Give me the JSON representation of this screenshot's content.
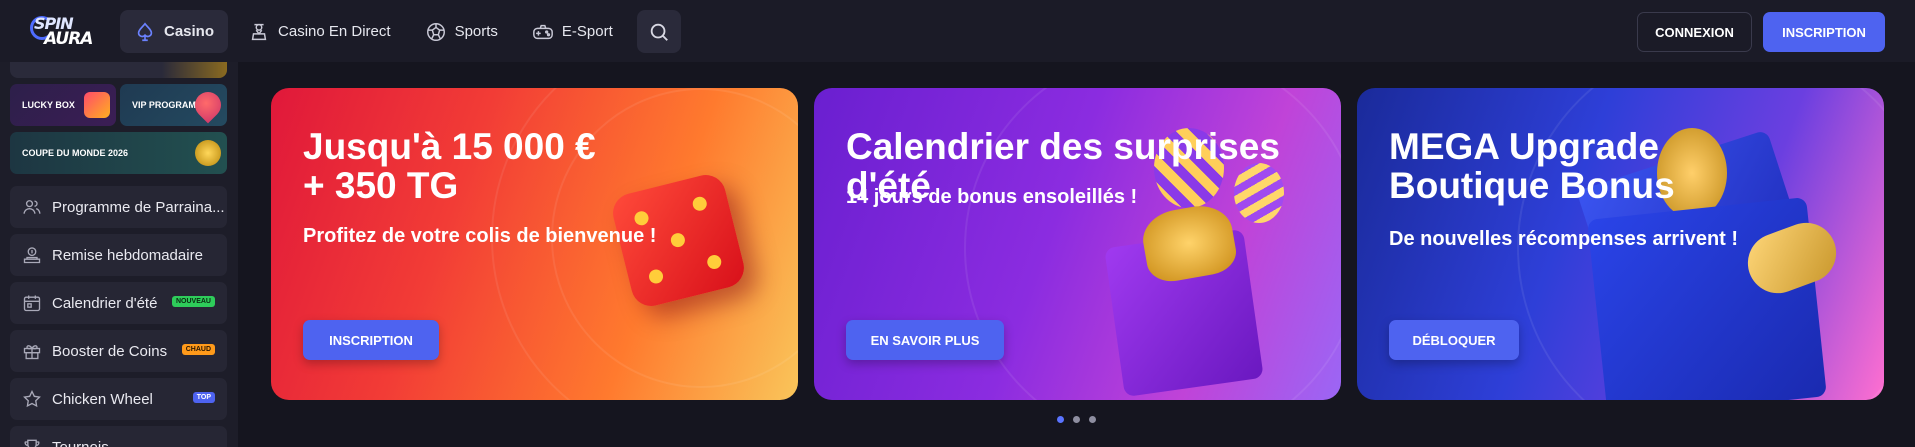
{
  "logo": {
    "line1": "SPIN",
    "line2": "AURA"
  },
  "nav": {
    "items": [
      {
        "label": "Casino",
        "icon": "spade-icon"
      },
      {
        "label": "Casino En Direct",
        "icon": "dealer-icon"
      },
      {
        "label": "Sports",
        "icon": "soccer-ball-icon"
      },
      {
        "label": "E-Sport",
        "icon": "gamepad-icon"
      }
    ],
    "search_icon": "search-icon"
  },
  "auth": {
    "login_label": "CONNEXION",
    "signup_label": "INSCRIPTION"
  },
  "sidebar": {
    "promos": [
      {
        "label": "LUCKY BOX"
      },
      {
        "label": "VIP PROGRAM"
      },
      {
        "label": "COUPE DU MONDE 2026"
      }
    ],
    "items": [
      {
        "label": "Programme de Parraina...",
        "icon": "users-icon",
        "badge": ""
      },
      {
        "label": "Remise hebdomadaire",
        "icon": "cashback-icon",
        "badge": ""
      },
      {
        "label": "Calendrier d'été",
        "icon": "calendar-icon",
        "badge": "NOUVEAU"
      },
      {
        "label": "Booster de Coins",
        "icon": "gift-icon",
        "badge": "CHAUD"
      },
      {
        "label": "Chicken Wheel",
        "icon": "star-icon",
        "badge": "TOP"
      },
      {
        "label": "Tournois",
        "icon": "trophy-icon",
        "badge": ""
      }
    ]
  },
  "banners": [
    {
      "title_line1": "Jusqu'à 15 000 €",
      "title_line2": "+ 350 TG",
      "subtitle": "Profitez de votre colis de bienvenue !",
      "button": "INSCRIPTION"
    },
    {
      "title_line1": "Calendrier des surprises d'été",
      "title_line2": "",
      "subtitle": "14 jours de bonus ensoleillés !",
      "button": "EN SAVOIR PLUS"
    },
    {
      "title_line1": "MEGA Upgrade",
      "title_line2": "Boutique Bonus",
      "subtitle": "De nouvelles récompenses arrivent !",
      "button": "DÉBLOQUER"
    }
  ],
  "carousel": {
    "count": 3,
    "active_index": 0
  },
  "colors": {
    "accent": "#4e63f0",
    "background": "#15151f",
    "header": "#1b1b27",
    "sidebar": "#1d1d29"
  }
}
